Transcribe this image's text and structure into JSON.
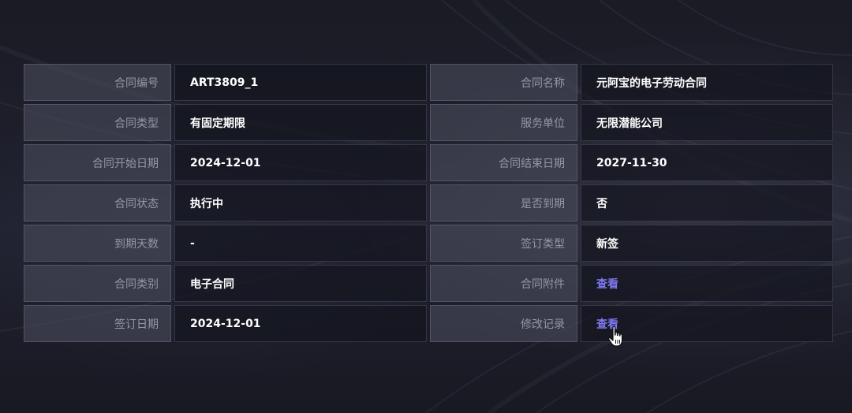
{
  "contract": {
    "left": [
      {
        "label": "合同编号",
        "value": "ART3809_1"
      },
      {
        "label": "合同类型",
        "value": "有固定期限"
      },
      {
        "label": "合同开始日期",
        "value": "2024-12-01"
      },
      {
        "label": "合同状态",
        "value": "执行中"
      },
      {
        "label": "到期天数",
        "value": "-"
      },
      {
        "label": "合同类别",
        "value": "电子合同"
      },
      {
        "label": "签订日期",
        "value": "2024-12-01"
      }
    ],
    "right": [
      {
        "label": "合同名称",
        "value": "元阿宝的电子劳动合同"
      },
      {
        "label": "服务单位",
        "value": "无限潜能公司"
      },
      {
        "label": "合同结束日期",
        "value": "2027-11-30"
      },
      {
        "label": "是否到期",
        "value": "否"
      },
      {
        "label": "签订类型",
        "value": "新签"
      },
      {
        "label": "合同附件",
        "value": "查看"
      },
      {
        "label": "修改记录",
        "value": "查看"
      }
    ]
  },
  "colors": {
    "link": "#7f79f2",
    "label_text": "#9597a6",
    "value_text": "#ffffff"
  },
  "icons": {
    "cursor": "hand-pointer-icon"
  }
}
